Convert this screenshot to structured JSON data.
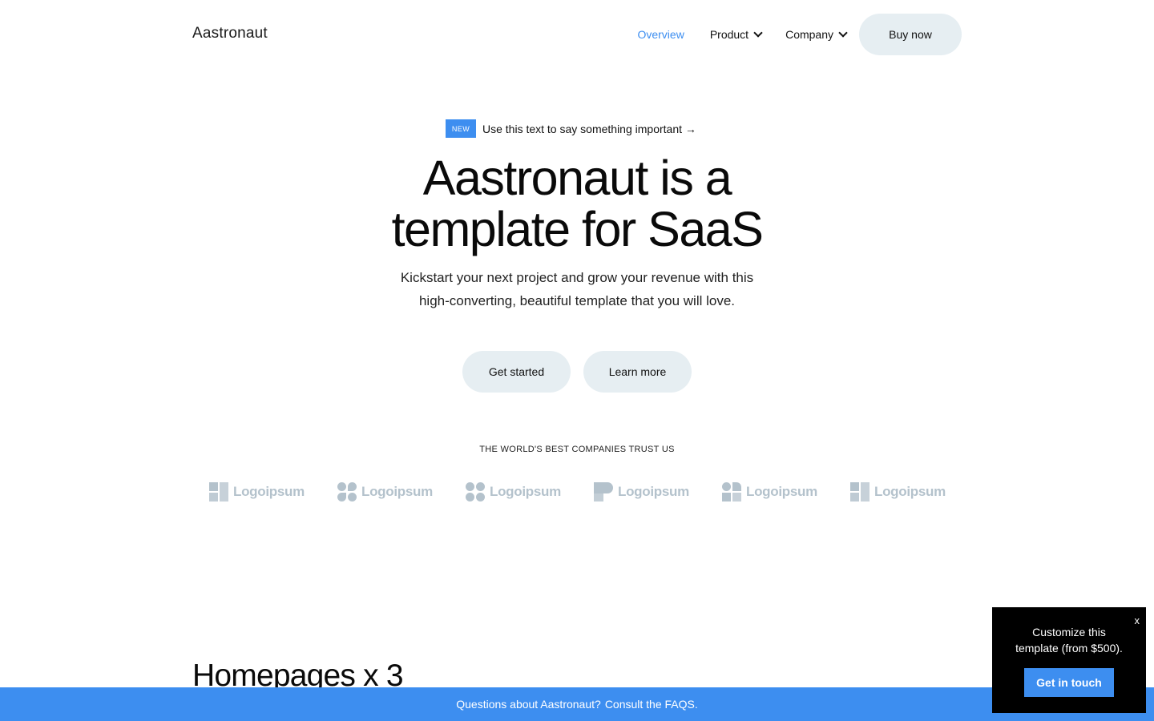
{
  "header": {
    "brand": "Aastronaut",
    "nav": [
      {
        "label": "Overview"
      },
      {
        "label": "Product"
      },
      {
        "label": "Company"
      }
    ],
    "buy_label": "Buy now"
  },
  "hero": {
    "badge": "NEW",
    "announcement": "Use this text to say something important →",
    "title_line1": "Aastronaut is a",
    "title_line2": "template for SaaS",
    "subtitle_line1": "Kickstart your next project and grow your revenue with this",
    "subtitle_line2": "high-converting, beautiful template that you will love.",
    "cta_primary": "Get started",
    "cta_secondary": "Learn more"
  },
  "trust": {
    "heading": "THE WORLD'S BEST COMPANIES TRUST US",
    "logos": [
      {
        "name": "Logoipsum",
        "icon": "squares-logo-icon"
      },
      {
        "name": "Logoipsum",
        "icon": "flower-logo-icon"
      },
      {
        "name": "Logoipsum",
        "icon": "circles-logo-icon"
      },
      {
        "name": "Logoipsum",
        "icon": "bookmark-logo-icon"
      },
      {
        "name": "Logoipsum",
        "icon": "tiles-logo-icon"
      },
      {
        "name": "Logoipsum",
        "icon": "squares-logo-icon"
      }
    ],
    "logo_color": "#b4c2cc"
  },
  "section": {
    "title": "Homepages x 3"
  },
  "bottom_bar": {
    "text": "Questions about Aastronaut?",
    "link": "Consult the FAQS."
  },
  "popup": {
    "close": "x",
    "text_line1": "Customize this",
    "text_line2": "template (from $500).",
    "button": "Get in touch"
  },
  "colors": {
    "accent": "#3d8ef0",
    "button_bg": "#e6eef2",
    "text": "#111111"
  }
}
